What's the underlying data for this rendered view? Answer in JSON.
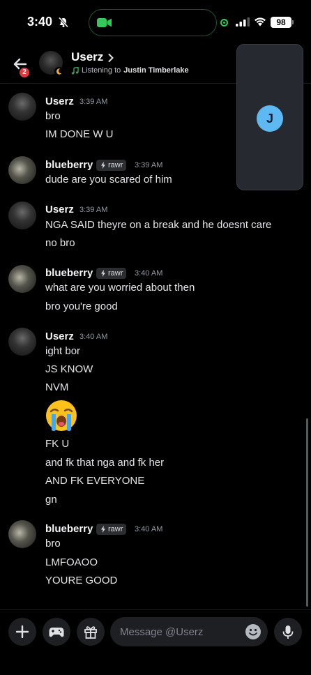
{
  "status_bar": {
    "time": "3:40",
    "battery": "98"
  },
  "header": {
    "badge": "2",
    "name": "Userz",
    "activity_prefix": "Listening to",
    "activity_artist": "Justin Timberlake"
  },
  "call": {
    "avatar_letter": "J"
  },
  "groups": [
    {
      "author": "Userz",
      "time": "3:39 AM",
      "lines": [
        "bro",
        "IM DONE W U"
      ]
    },
    {
      "author": "blueberry",
      "tag": "rawr",
      "time": "3:39 AM",
      "lines": [
        "dude are you scared of him"
      ]
    },
    {
      "author": "Userz",
      "time": "3:39 AM",
      "lines": [
        "NGA SAID theyre on a break and he doesnt care",
        "no bro"
      ]
    },
    {
      "author": "blueberry",
      "tag": "rawr",
      "time": "3:40 AM",
      "lines": [
        "what are you worried about then",
        "bro you're good"
      ]
    },
    {
      "author": "Userz",
      "time": "3:40 AM",
      "lines": [
        "ight bor",
        "JS KNOW",
        "NVM",
        "😭",
        "FK U",
        "and fk that nga and fk her",
        "AND FK EVERYONE",
        "gn"
      ]
    },
    {
      "author": "blueberry",
      "tag": "rawr",
      "time": "3:40 AM",
      "lines": [
        "bro",
        "LMFOAOO",
        "YOURE GOOD"
      ]
    }
  ],
  "composer": {
    "placeholder": "Message @Userz"
  },
  "icons": {
    "back": "arrow-left-icon",
    "moon": "moon-status-icon",
    "note": "music-note-icon",
    "add": "plus-icon",
    "games": "gamepad-icon",
    "gift": "gift-icon",
    "emoji": "smiley-icon",
    "mic": "microphone-icon",
    "tag": "lightning-icon"
  },
  "colors": {
    "accent": "#5eb8f2",
    "badge": "#e0383e",
    "online": "#34c759",
    "background": "#000000"
  }
}
